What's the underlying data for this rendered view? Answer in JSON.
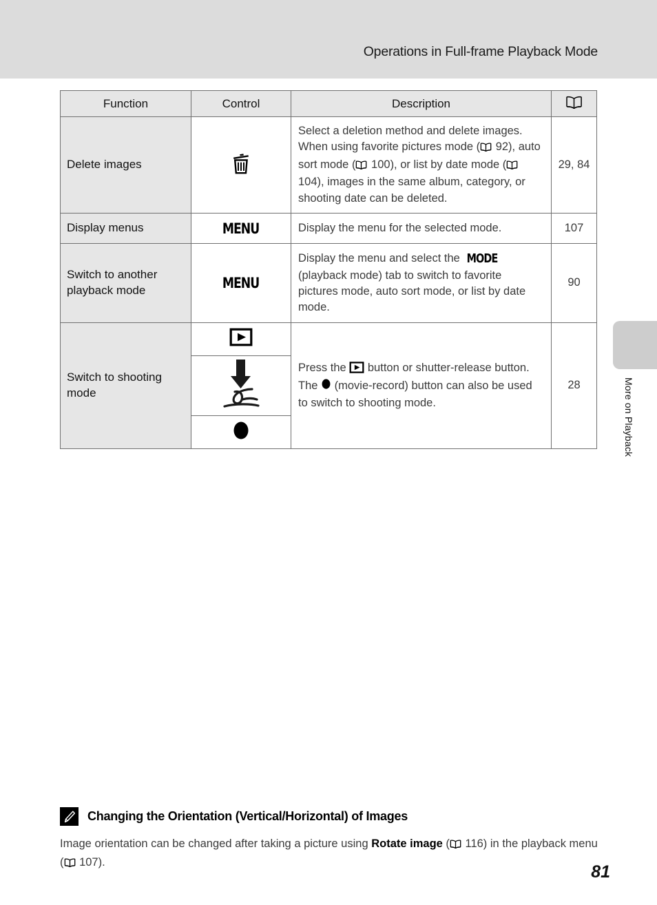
{
  "header": {
    "title": "Operations in Full-frame Playback Mode"
  },
  "side_tab": {
    "label": "More on Playback",
    "color": "#cdcdcd"
  },
  "table": {
    "columns": [
      {
        "key": "function",
        "label": "Function"
      },
      {
        "key": "control",
        "label": "Control"
      },
      {
        "key": "description",
        "label": "Description"
      },
      {
        "key": "page",
        "label": "",
        "icon": "book-icon"
      }
    ],
    "rows": [
      {
        "function": "Delete images",
        "control_icons": [
          "trash-icon"
        ],
        "description_parts": [
          {
            "t": "text",
            "v": "Select a deletion method and delete images."
          },
          {
            "t": "br"
          },
          {
            "t": "text",
            "v": "When using favorite pictures mode ("
          },
          {
            "t": "icon",
            "v": "book-icon"
          },
          {
            "t": "text",
            "v": " 92), auto sort mode ("
          },
          {
            "t": "icon",
            "v": "book-icon"
          },
          {
            "t": "text",
            "v": " 100), or list by date mode ("
          },
          {
            "t": "icon",
            "v": "book-icon"
          },
          {
            "t": "text",
            "v": " 104), images in the same album, category, or shooting date can be deleted."
          }
        ],
        "page": "29, 84"
      },
      {
        "function": "Display menus",
        "control_icons": [
          "menu-button-icon"
        ],
        "control_text": "MENU",
        "description_parts": [
          {
            "t": "text",
            "v": "Display the menu for the selected mode."
          }
        ],
        "page": "107"
      },
      {
        "function": "Switch to another playback mode",
        "control_icons": [
          "menu-button-icon"
        ],
        "control_text": "MENU",
        "description_parts": [
          {
            "t": "text",
            "v": "Display the menu and select the "
          },
          {
            "t": "mode",
            "v": "MODE"
          },
          {
            "t": "text",
            "v": " (playback mode) tab to switch to favorite pictures mode, auto sort mode, or list by date mode."
          }
        ],
        "page": "90"
      },
      {
        "function": "Switch to shooting mode",
        "control_icons": [
          "playback-button-icon",
          "shutter-release-press-icon",
          "movie-record-button-icon"
        ],
        "description_parts": [
          {
            "t": "text",
            "v": "Press the "
          },
          {
            "t": "icon",
            "v": "playback-button-icon"
          },
          {
            "t": "text",
            "v": " button or shutter-release button. The "
          },
          {
            "t": "icon",
            "v": "movie-record-dot-icon"
          },
          {
            "t": "text",
            "v": " (movie-record) button can also be used to switch to shooting mode."
          }
        ],
        "page": "28"
      }
    ]
  },
  "note": {
    "badge_icon": "pencil-note-icon",
    "title": "Changing the Orientation (Vertical/Horizontal) of Images",
    "body_parts": [
      {
        "t": "text",
        "v": "Image orientation can be changed after taking a picture using "
      },
      {
        "t": "bold",
        "v": "Rotate image"
      },
      {
        "t": "text",
        "v": " ("
      },
      {
        "t": "icon",
        "v": "book-icon"
      },
      {
        "t": "text",
        "v": " 116) in the playback menu ("
      },
      {
        "t": "icon",
        "v": "book-icon"
      },
      {
        "t": "text",
        "v": " 107)."
      }
    ]
  },
  "page_number": "81"
}
